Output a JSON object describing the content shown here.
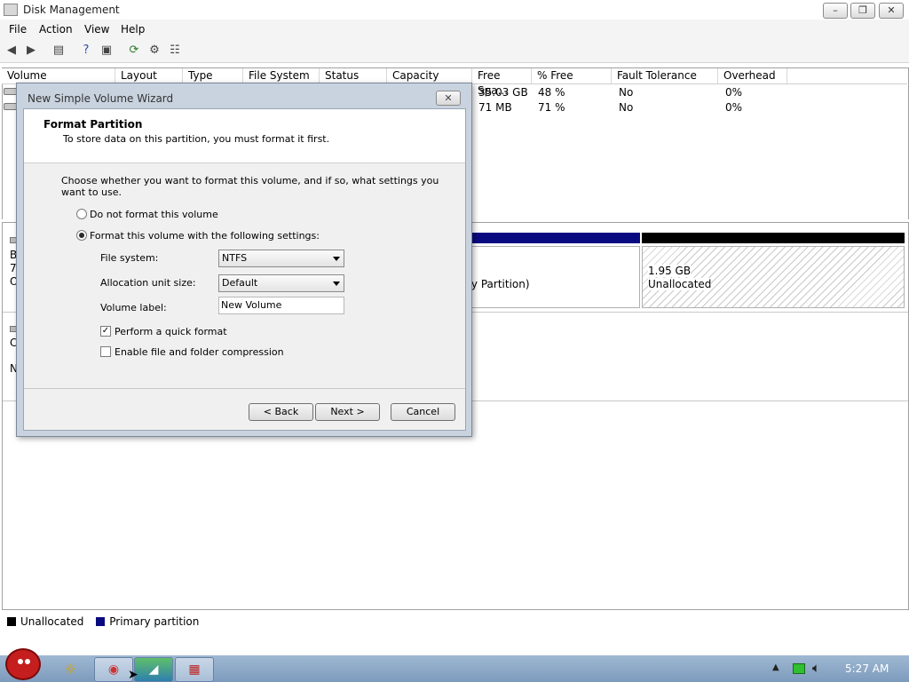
{
  "window": {
    "title": "Disk Management"
  },
  "menu": [
    "File",
    "Action",
    "View",
    "Help"
  ],
  "columns": [
    "Volume",
    "Layout",
    "Type",
    "File System",
    "Status",
    "Capacity",
    "Free Spa...",
    "% Free",
    "Fault Tolerance",
    "Overhead"
  ],
  "rows": [
    {
      "free": "35.03 GB",
      "pct": "48 %",
      "fault": "No",
      "overhead": "0%"
    },
    {
      "free": "71 MB",
      "pct": "71 %",
      "fault": "No",
      "overhead": "0%"
    }
  ],
  "disk": {
    "left_fragment_1": "B",
    "left_fragment_2": "7.",
    "left_fragment_3": "O",
    "left_fragment_4": "C",
    "left_fragment_5": "N",
    "partition_suffix": "ry Partition)",
    "unallocated_size": "1.95 GB",
    "unallocated_label": "Unallocated"
  },
  "legend": {
    "unallocated": "Unallocated",
    "primary": "Primary partition"
  },
  "colors": {
    "primary": "#0a0a80",
    "unallocated": "#000000"
  },
  "dialog": {
    "title": "New Simple Volume Wizard",
    "heading": "Format Partition",
    "subheading": "To store data on this partition, you must format it first.",
    "instruction": "Choose whether you want to format this volume, and if so, what settings you want to use.",
    "opt_no_format": "Do not format this volume",
    "opt_format": "Format this volume with the following settings:",
    "fs_label": "File system:",
    "fs_value": "NTFS",
    "alloc_label": "Allocation unit size:",
    "alloc_value": "Default",
    "vol_label": "Volume label:",
    "vol_value": "New Volume",
    "quick_format": "Perform a quick format",
    "compression": "Enable file and folder compression",
    "back": "< Back",
    "next": "Next >",
    "cancel": "Cancel"
  },
  "taskbar": {
    "clock": "5:27 AM"
  }
}
